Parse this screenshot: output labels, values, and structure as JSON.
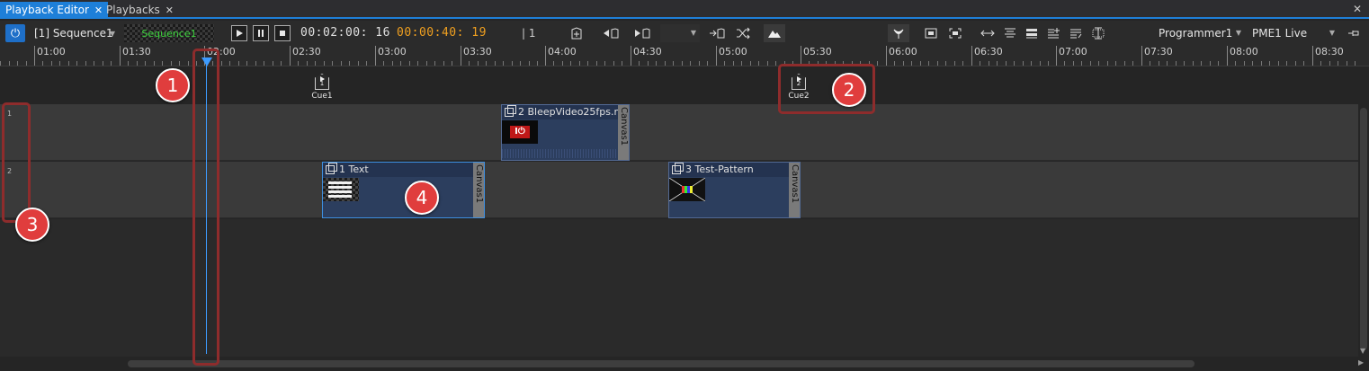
{
  "tabs": [
    {
      "label": "Playback Editor",
      "close": "✕"
    },
    {
      "label": "Playbacks",
      "close": "✕"
    }
  ],
  "window": {
    "close": "✕"
  },
  "toolbar": {
    "sequence": "[1] Sequence1",
    "preview": "Sequence1",
    "current_time": "00:02:00: 16",
    "total_time": "00:00:40: 19",
    "count": "| 1",
    "programmer": "Programmer1",
    "output": "PME1 Live"
  },
  "ruler": {
    "labels": [
      "01:00",
      "01:30",
      "02:00",
      "02:30",
      "03:00",
      "03:30",
      "04:00",
      "04:30",
      "05:00",
      "05:30",
      "06:00",
      "06:30",
      "07:00",
      "07:30",
      "08:00",
      "08:30"
    ]
  },
  "cues": [
    {
      "num": "1",
      "label": "Cue1"
    },
    {
      "num": "2",
      "label": "Cue2"
    }
  ],
  "tracks": [
    {
      "num": "1"
    },
    {
      "num": "2"
    }
  ],
  "clips": [
    {
      "title": "2 BleepVideo25fps.m",
      "canvas": "Canvas1",
      "thumb_text": "I⏻"
    },
    {
      "title": "1 Text",
      "canvas": "Canvas1"
    },
    {
      "title": "3 Test-Pattern",
      "canvas": "Canvas1"
    }
  ],
  "annotations": [
    "1",
    "2",
    "3",
    "4"
  ],
  "colors": {
    "accent": "#1e7fd8",
    "playhead": "#3d9bff",
    "timecode_total": "#f0a020",
    "preview_text": "#3cd23c",
    "annotation": "#e03d3d"
  }
}
